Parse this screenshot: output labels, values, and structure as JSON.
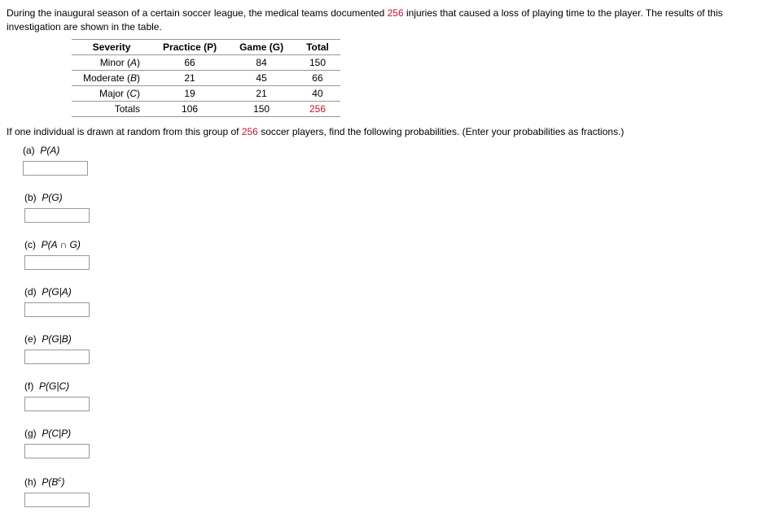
{
  "intro_prefix": "During the inaugural season of a certain soccer league, the medical teams documented ",
  "intro_count": "256",
  "intro_suffix": " injuries that caused a loss of playing time to the player. The results of this investigation are shown in the table.",
  "table": {
    "headers": [
      "Severity",
      "Practice (P)",
      "Game (G)",
      "Total"
    ],
    "rows": [
      {
        "label": "Minor (A)",
        "practice": "66",
        "game": "84",
        "total": "150"
      },
      {
        "label": "Moderate (B)",
        "practice": "21",
        "game": "45",
        "total": "66"
      },
      {
        "label": "Major (C)",
        "practice": "19",
        "game": "21",
        "total": "40"
      },
      {
        "label": "Totals",
        "practice": "106",
        "game": "150",
        "total": "256"
      }
    ]
  },
  "instruction_prefix": "If one individual is drawn at random from this group of ",
  "instruction_count": "256",
  "instruction_suffix": " soccer players, find the following probabilities. (Enter your probabilities as fractions.)",
  "questions": {
    "a": {
      "tag": "(a)",
      "label": "P(A)"
    },
    "b": {
      "tag": "(b)",
      "label": "P(G)"
    },
    "c": {
      "tag": "(c)",
      "label": "P(A ∩ G)"
    },
    "d": {
      "tag": "(d)",
      "label": "P(G|A)"
    },
    "e": {
      "tag": "(e)",
      "label": "P(G|B)"
    },
    "f": {
      "tag": "(f)",
      "label": "P(G|C)"
    },
    "g": {
      "tag": "(g)",
      "label": "P(C|P)"
    },
    "h": {
      "tag": "(h)",
      "label_html": "P(B<sup>c</sup>)"
    }
  }
}
